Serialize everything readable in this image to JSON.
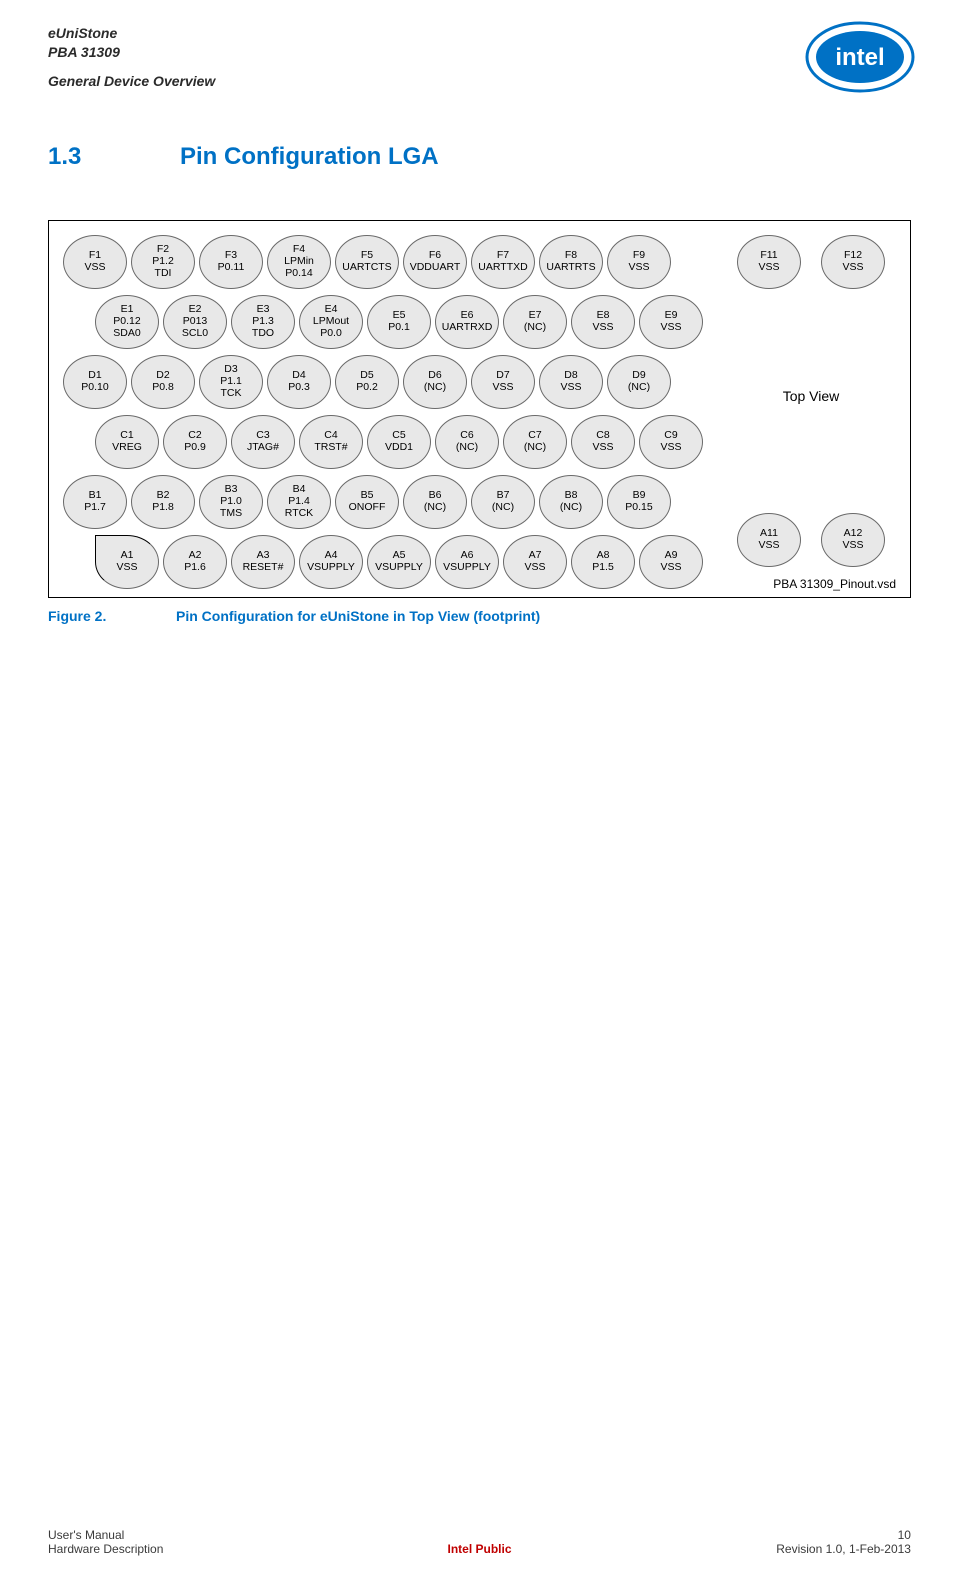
{
  "header": {
    "product": "eUniStone",
    "part": "PBA 31309",
    "overview": "General Device Overview",
    "logo_alt": "intel"
  },
  "section": {
    "number": "1.3",
    "title": "Pin Configuration LGA"
  },
  "figure": {
    "box_label_topview": "Top View",
    "box_label_vsd": "PBA 31309_Pinout.vsd",
    "caption_lead": "Figure 2.",
    "caption_text": "Pin Configuration for eUniStone in Top View (footprint)"
  },
  "pins": {
    "F": [
      {
        "id": "F1",
        "l1": "VSS"
      },
      {
        "id": "F2",
        "l1": "P1.2",
        "l2": "TDI"
      },
      {
        "id": "F3",
        "l1": "P0.11"
      },
      {
        "id": "F4",
        "l1": "LPMin",
        "l2": "P0.14"
      },
      {
        "id": "F5",
        "l1": "UARTCTS"
      },
      {
        "id": "F6",
        "l1": "VDDUART"
      },
      {
        "id": "F7",
        "l1": "UARTTXD"
      },
      {
        "id": "F8",
        "l1": "UARTRTS"
      },
      {
        "id": "F9",
        "l1": "VSS"
      }
    ],
    "E": [
      {
        "id": "E1",
        "l1": "P0.12",
        "l2": "SDA0"
      },
      {
        "id": "E2",
        "l1": "P013",
        "l2": "SCL0"
      },
      {
        "id": "E3",
        "l1": "P1.3",
        "l2": "TDO"
      },
      {
        "id": "E4",
        "l1": "LPMout",
        "l2": "P0.0"
      },
      {
        "id": "E5",
        "l1": "P0.1"
      },
      {
        "id": "E6",
        "l1": "UARTRXD"
      },
      {
        "id": "E7",
        "l1": "(NC)"
      },
      {
        "id": "E8",
        "l1": "VSS"
      },
      {
        "id": "E9",
        "l1": "VSS"
      }
    ],
    "D": [
      {
        "id": "D1",
        "l1": "P0.10"
      },
      {
        "id": "D2",
        "l1": "P0.8"
      },
      {
        "id": "D3",
        "l1": "P1.1",
        "l2": "TCK"
      },
      {
        "id": "D4",
        "l1": "P0.3"
      },
      {
        "id": "D5",
        "l1": "P0.2"
      },
      {
        "id": "D6",
        "l1": "(NC)"
      },
      {
        "id": "D7",
        "l1": "VSS"
      },
      {
        "id": "D8",
        "l1": "VSS"
      },
      {
        "id": "D9",
        "l1": "(NC)"
      }
    ],
    "C": [
      {
        "id": "C1",
        "l1": "VREG"
      },
      {
        "id": "C2",
        "l1": "P0.9"
      },
      {
        "id": "C3",
        "l1": "JTAG#"
      },
      {
        "id": "C4",
        "l1": "TRST#"
      },
      {
        "id": "C5",
        "l1": "VDD1"
      },
      {
        "id": "C6",
        "l1": "(NC)"
      },
      {
        "id": "C7",
        "l1": "(NC)"
      },
      {
        "id": "C8",
        "l1": "VSS"
      },
      {
        "id": "C9",
        "l1": "VSS"
      }
    ],
    "B": [
      {
        "id": "B1",
        "l1": "P1.7"
      },
      {
        "id": "B2",
        "l1": "P1.8"
      },
      {
        "id": "B3",
        "l1": "P1.0",
        "l2": "TMS"
      },
      {
        "id": "B4",
        "l1": "P1.4",
        "l2": "RTCK"
      },
      {
        "id": "B5",
        "l1": "ONOFF"
      },
      {
        "id": "B6",
        "l1": "(NC)"
      },
      {
        "id": "B7",
        "l1": "(NC)"
      },
      {
        "id": "B8",
        "l1": "(NC)"
      },
      {
        "id": "B9",
        "l1": "P0.15"
      }
    ],
    "A": [
      {
        "id": "A1",
        "l1": "VSS"
      },
      {
        "id": "A2",
        "l1": "P1.6"
      },
      {
        "id": "A3",
        "l1": "RESET#"
      },
      {
        "id": "A4",
        "l1": "VSUPPLY"
      },
      {
        "id": "A5",
        "l1": "VSUPPLY"
      },
      {
        "id": "A6",
        "l1": "VSUPPLY"
      },
      {
        "id": "A7",
        "l1": "VSS"
      },
      {
        "id": "A8",
        "l1": "P1.5"
      },
      {
        "id": "A9",
        "l1": "VSS"
      }
    ],
    "right_top": [
      {
        "id": "F11",
        "l1": "VSS"
      },
      {
        "id": "F12",
        "l1": "VSS"
      }
    ],
    "right_bot": [
      {
        "id": "A11",
        "l1": "VSS"
      },
      {
        "id": "A12",
        "l1": "VSS"
      }
    ]
  },
  "footer": {
    "left1": "User's Manual",
    "left2": "Hardware Description",
    "center": "Intel Public",
    "right1": "10",
    "right2": "Revision 1.0, 1-Feb-2013"
  }
}
